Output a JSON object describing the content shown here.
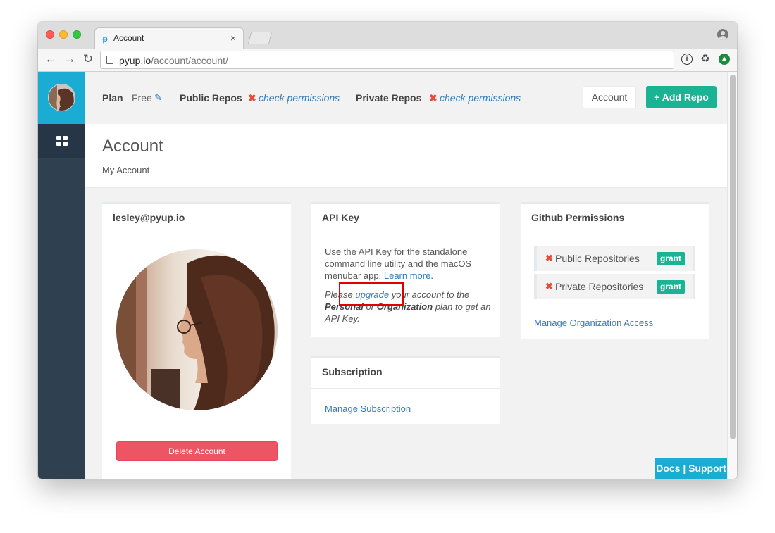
{
  "browser": {
    "tab_title": "Account",
    "tab_close": "×",
    "url_host": "pyup.io",
    "url_path": "/account/account/",
    "back": "←",
    "forward": "→",
    "reload": "↻"
  },
  "topbar": {
    "plan_label": "Plan",
    "plan_value": "Free",
    "public_repos_label": "Public Repos",
    "public_repos_link": "check permissions",
    "private_repos_label": "Private Repos",
    "private_repos_link": "check permissions",
    "account_button": "Account",
    "add_repo_button": "+ Add Repo",
    "status_mark": "✖"
  },
  "page": {
    "title": "Account",
    "breadcrumb": "My Account"
  },
  "profile_card": {
    "email": "lesley@pyup.io",
    "delete_button": "Delete Account"
  },
  "api_card": {
    "title": "API Key",
    "description": "Use the API Key for the standalone command line utility and the macOS menubar app.",
    "learn_more": "Learn more",
    "period": ".",
    "note_prefix": "Please",
    "upgrade_link": "upgrade",
    "note_middle": "your account to the",
    "plan_personal": "Personal",
    "note_or": "or",
    "plan_org": "Organization",
    "note_suffix": "plan to get an API Key."
  },
  "subscription_card": {
    "title": "Subscription",
    "link": "Manage Subscription"
  },
  "github_card": {
    "title": "Github Permissions",
    "permissions": [
      {
        "name": "Public Repositories",
        "badge": "grant"
      },
      {
        "name": "Private Repositories",
        "badge": "grant"
      }
    ],
    "org_link": "Manage Organization Access"
  },
  "footer": {
    "docs": "Docs",
    "separator": "|",
    "support": "Support"
  },
  "colors": {
    "sidebar": "#2f4050",
    "accent_blue": "#1bacd4",
    "primary_green": "#1ab394",
    "danger_red": "#ed5565",
    "link": "#337ab7"
  }
}
